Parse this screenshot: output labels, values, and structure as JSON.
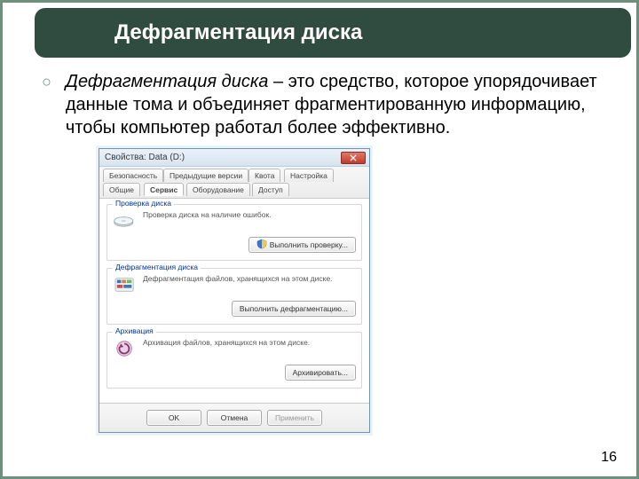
{
  "title": "Дефрагментация диска",
  "bullet": {
    "term": "Дефрагментация диска",
    "rest": " – это средство, которое упорядочивает данные тома и объединяет фрагментированную информацию, чтобы компьютер работал более эффективно."
  },
  "page_number": "16",
  "dialog": {
    "window_title": "Свойства: Data (D:)",
    "close_icon": "close-icon",
    "tabs_row1": [
      "Безопасность",
      "Предыдущие версии",
      "Квота",
      "Настройка"
    ],
    "tabs_row2": [
      "Общие",
      "Сервис",
      "Оборудование",
      "Доступ"
    ],
    "active_tab": "Сервис",
    "groups": {
      "check": {
        "legend": "Проверка диска",
        "text": "Проверка диска на наличие ошибок.",
        "button": "Выполнить проверку..."
      },
      "defrag": {
        "legend": "Дефрагментация диска",
        "text": "Дефрагментация файлов, хранящихся на этом диске.",
        "button": "Выполнить дефрагментацию..."
      },
      "archive": {
        "legend": "Архивация",
        "text": "Архивация файлов, хранящихся на этом диске.",
        "button": "Архивировать..."
      }
    },
    "buttons": {
      "ok": "OK",
      "cancel": "Отмена",
      "apply": "Применить"
    }
  }
}
